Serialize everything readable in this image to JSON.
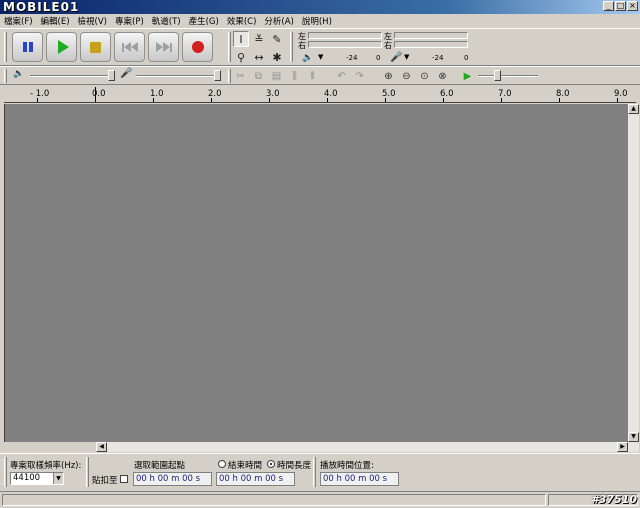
{
  "titlebar": {
    "logo": "MOBILE01",
    "min": "_",
    "max": "□",
    "close": "×"
  },
  "menu": [
    "檔案(F)",
    "編輯(E)",
    "檢視(V)",
    "專案(P)",
    "軌道(T)",
    "產生(G)",
    "效果(C)",
    "分析(A)",
    "說明(H)"
  ],
  "meters": {
    "left": "左",
    "right": "右",
    "scale_a": "-24",
    "scale_b": "0",
    "scale_c": "-24",
    "scale_d": "0"
  },
  "ruler": {
    "labels": [
      "- 1.0",
      "0.0",
      "1.0",
      "2.0",
      "3.0",
      "4.0",
      "5.0",
      "6.0",
      "7.0",
      "8.0",
      "9.0"
    ]
  },
  "selection": {
    "rate_label": "專案取樣頻率(Hz):",
    "rate_value": "44100",
    "snap_label": "貼扣至",
    "sel_start_label": "選取範圍起點",
    "end_label": "結束時間",
    "length_label": "時間長度",
    "play_pos_label": "播放時間位置:",
    "time_start": "00 h 00 m 00 s",
    "time_end": "00 h 00 m 00 s",
    "time_play": "00 h 00 m 00 s"
  },
  "status": {
    "watermark": "#37510"
  }
}
